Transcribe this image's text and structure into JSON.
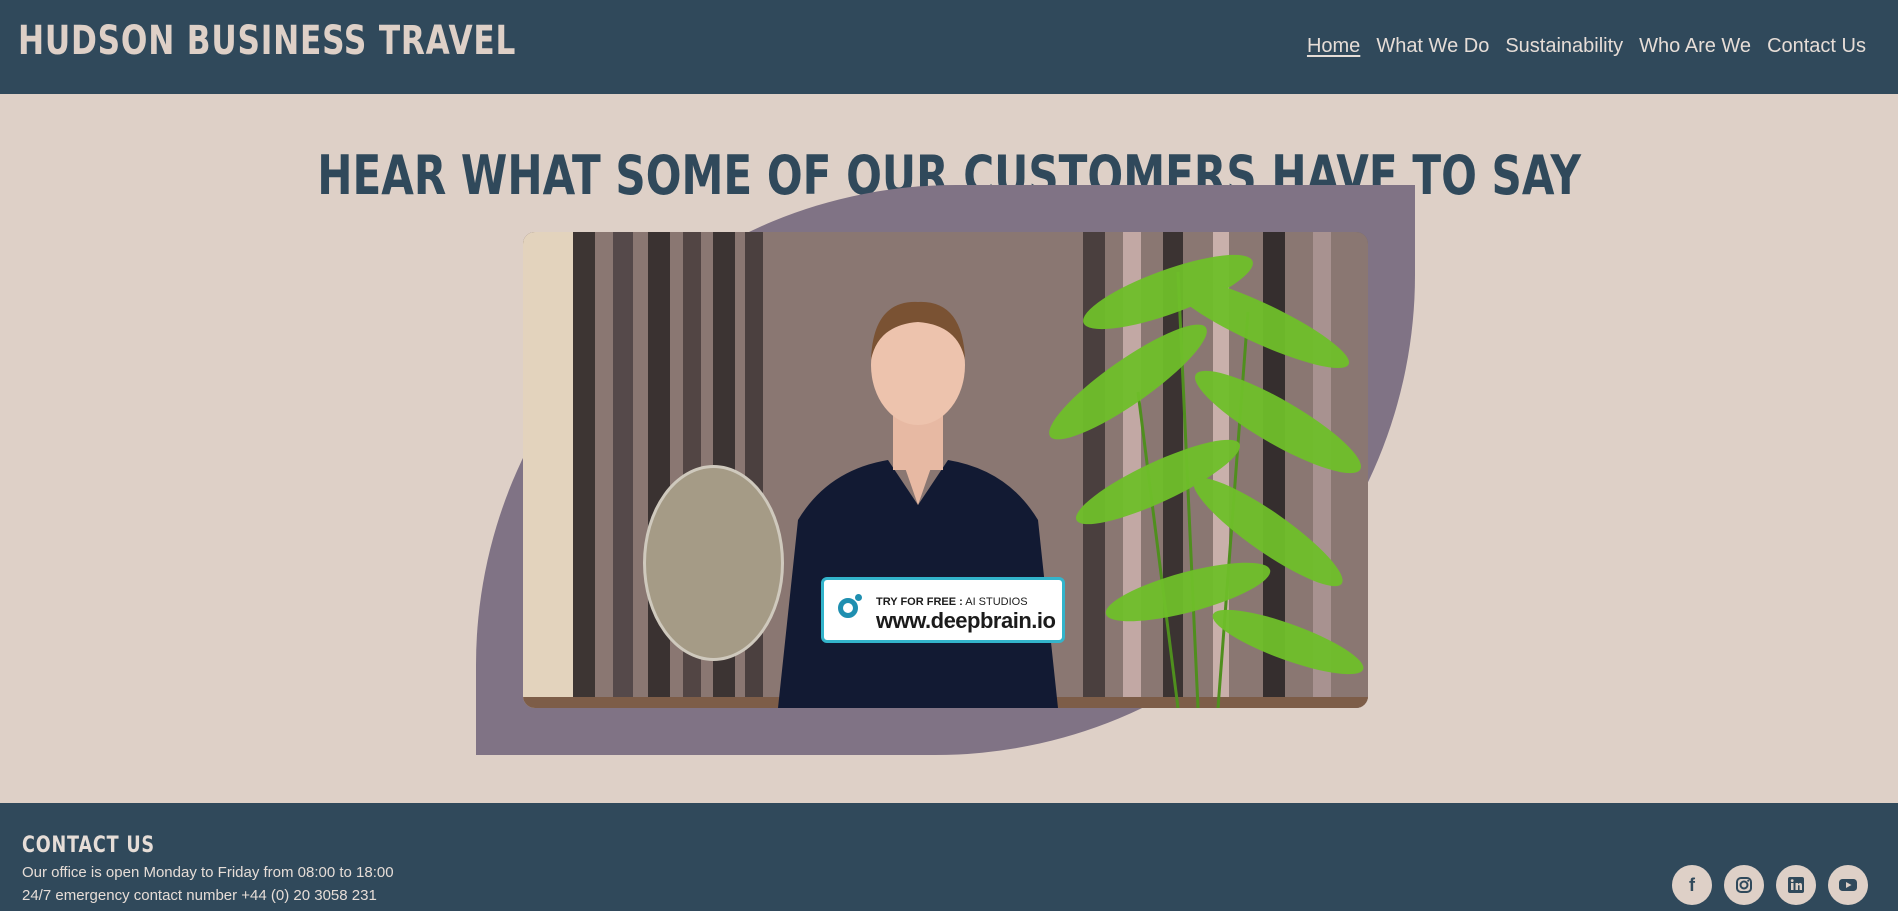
{
  "header": {
    "brand": "HUDSON BUSINESS TRAVEL",
    "nav": [
      {
        "label": "Home",
        "active": true
      },
      {
        "label": "What We Do",
        "active": false
      },
      {
        "label": "Sustainability",
        "active": false
      },
      {
        "label": "Who Are We",
        "active": false
      },
      {
        "label": "Contact Us",
        "active": false
      }
    ]
  },
  "main": {
    "heading": "HEAR WHAT SOME OF OUR CUSTOMERS HAVE TO SAY",
    "video": {
      "banner_small_bold": "TRY FOR FREE :",
      "banner_small": "AI STUDIOS",
      "banner_url": "www.deepbrain.io"
    }
  },
  "footer": {
    "title": "CONTACT US",
    "line1": "Our office is open Monday to Friday from 08:00 to 18:00",
    "line2": "24/7 emergency contact number +44 (0) 20 3058 231",
    "socials": [
      "facebook-icon",
      "instagram-icon",
      "linkedin-icon",
      "youtube-icon"
    ]
  },
  "colors": {
    "navy": "#30495b",
    "beige": "#ded0c7",
    "mauve": "#807385",
    "accent": "#33b4cb"
  }
}
